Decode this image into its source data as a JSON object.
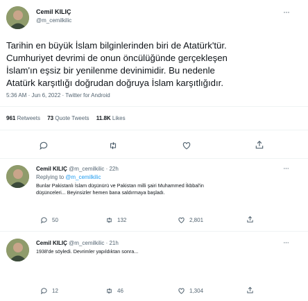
{
  "main_tweet": {
    "author_name": "Cemil KILIÇ",
    "handle": "@m_cemilkilic",
    "text_lines": [
      "Tarihin en büyük İslam bilginlerinden biri de Atatürk'tür.",
      "Cumhuriyet devrimi de onun öncülüğünde gerçekleşen",
      "İslam'ın eşsiz bir yenilenme devinimidir. Bu nedenle",
      "Atatürk karşıtlığı doğrudan doğruya İslam karşıtlığıdır."
    ],
    "meta": "5:36 AM · Jun 6, 2022 · Twitter for Android",
    "stats": {
      "retweets_count": "961",
      "retweets_label": "Retweets",
      "quotes_count": "73",
      "quotes_label": "Quote Tweets",
      "likes_count": "11.8K",
      "likes_label": "Likes"
    },
    "more_glyph": "···",
    "actions": [
      "reply-icon",
      "retweet-icon",
      "like-icon",
      "share-icon"
    ]
  },
  "replies": [
    {
      "author_name": "Cemil KILIÇ",
      "handle_time": "@m_cemilkilic · 22h",
      "replying_prefix": "Replying to ",
      "replying_handle": "@m_cemilkilic",
      "text_lines": [
        "Bunlar Pakistanlı İslam düşünürü ve Pakistan milli şairi Muhammed İkbbal'in",
        "düşünceleri... Beyinsizler hemen bana saldırmaya başladı."
      ],
      "reply_count": "50",
      "retweet_count": "132",
      "like_count": "2,801"
    },
    {
      "author_name": "Cemil KILIÇ",
      "handle_time": "@m_cemilkilic · 21h",
      "text_lines": [
        "1938'de söyledi. Devrimler yapıldıktan sonra..."
      ],
      "reply_count": "12",
      "retweet_count": "46",
      "like_count": "1,304"
    }
  ],
  "colors": {
    "text": "#0f1419",
    "muted": "#536471",
    "link": "#1d9bf0",
    "divider": "#eff3f4"
  }
}
